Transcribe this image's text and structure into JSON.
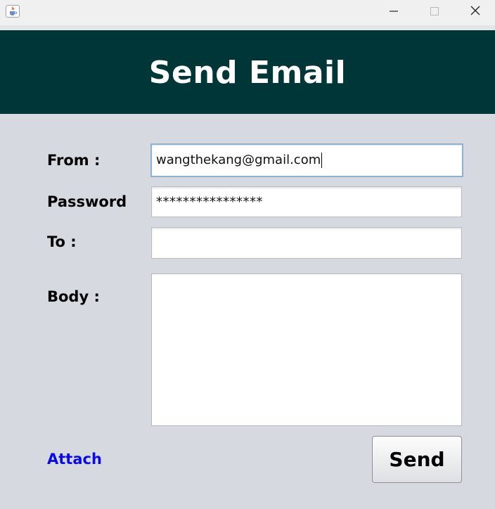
{
  "window": {
    "icon": "java-cup-icon",
    "controls": {
      "minimize_icon": "minimize-icon",
      "maximize_icon": "maximize-icon",
      "close_icon": "close-icon"
    }
  },
  "header": {
    "title": "Send Email",
    "background": "#003638"
  },
  "form": {
    "from_label": "From :",
    "from_value": "wangthekang@gmail.com",
    "password_label": "Password",
    "password_value": "****************",
    "to_label": "To :",
    "to_value": "",
    "body_label": "Body :",
    "body_value": ""
  },
  "actions": {
    "attach_label": "Attach",
    "attach_color": "#0a0ae6",
    "send_label": "Send"
  }
}
